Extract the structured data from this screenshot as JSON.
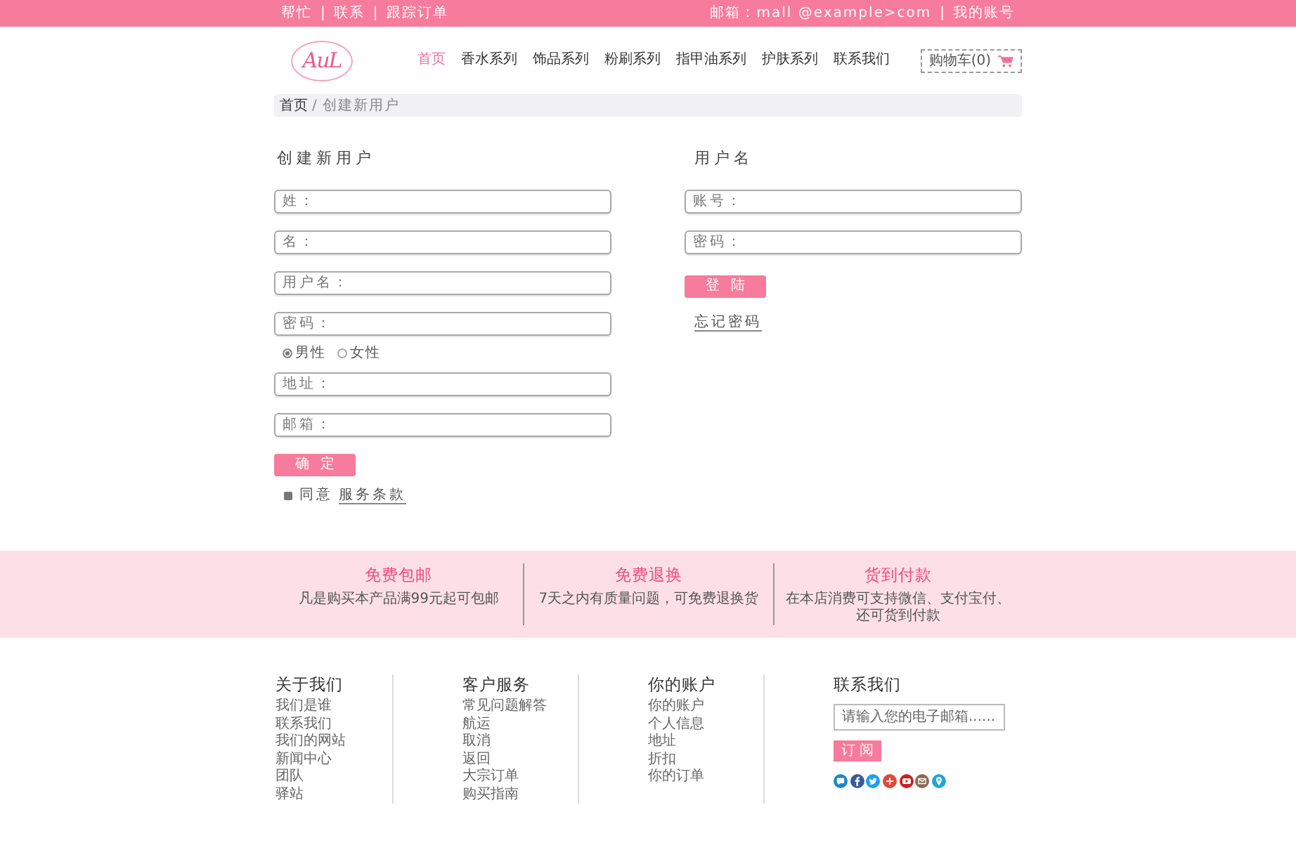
{
  "top_bar": {
    "left_links": [
      "帮忙",
      "联系",
      "跟踪订单"
    ],
    "right_links": [
      "邮箱：mall @example>com",
      "我的账号"
    ],
    "separator": "|"
  },
  "header": {
    "logo": {
      "text": "AuL"
    },
    "nav": [
      {
        "label": "首页",
        "selected": true
      },
      {
        "label": "香水系列",
        "selected": false
      },
      {
        "label": "饰品系列",
        "selected": false
      },
      {
        "label": "粉刷系列",
        "selected": false
      },
      {
        "label": "指甲油系列",
        "selected": false
      },
      {
        "label": "护肤系列",
        "selected": false
      },
      {
        "label": "联系我们",
        "selected": false
      }
    ],
    "cart": {
      "label": "购物车(0)"
    }
  },
  "breadcrumb": {
    "items": [
      "首页",
      "创建新用户"
    ],
    "separator": "/"
  },
  "register": {
    "title": "创建新用户",
    "rows": [
      {
        "kind": "field",
        "placeholder": "姓："
      },
      {
        "kind": "field",
        "placeholder": "名："
      },
      {
        "kind": "field",
        "placeholder": "用户名："
      },
      {
        "kind": "field",
        "placeholder": "密码："
      },
      {
        "kind": "radio_group",
        "options": [
          {
            "label": "男性",
            "selected": true
          },
          {
            "label": "女性",
            "selected": false
          }
        ]
      },
      {
        "kind": "field",
        "placeholder": "地址："
      },
      {
        "kind": "field",
        "placeholder": "邮箱："
      }
    ],
    "submit": "确定",
    "agree": {
      "checked": true,
      "label": "同意",
      "link": "服务条款"
    }
  },
  "login": {
    "title": "用户名",
    "fields": [
      {
        "placeholder": "账号："
      },
      {
        "placeholder": "密码："
      }
    ],
    "submit": "登陆",
    "forgot": "忘记密码"
  },
  "features": [
    {
      "title": "免费包邮",
      "text": "凡是购买本产品满99元起可包邮"
    },
    {
      "title": "免费退换",
      "text": "7天之内有质量问题，可免费退换货"
    },
    {
      "title": "货到付款",
      "text": "在本店消费可支持微信、支付宝付、还可货到付款"
    }
  ],
  "footer": {
    "columns": [
      {
        "title": "关于我们",
        "links": [
          "我们是谁",
          "联系我们",
          "我们的网站",
          "新闻中心",
          "团队",
          "驿站"
        ]
      },
      {
        "title": "客户服务",
        "links": [
          "常见问题解答",
          "航运",
          "取消",
          "返回",
          "大宗订单",
          "购买指南"
        ]
      },
      {
        "title": "你的账户",
        "links": [
          "你的账户",
          "个人信息",
          "地址",
          "折扣",
          "你的订单"
        ]
      }
    ],
    "contact": {
      "title": "联系我们",
      "placeholder": "请输入您的电子邮箱......",
      "subscribe": "订阅"
    }
  }
}
